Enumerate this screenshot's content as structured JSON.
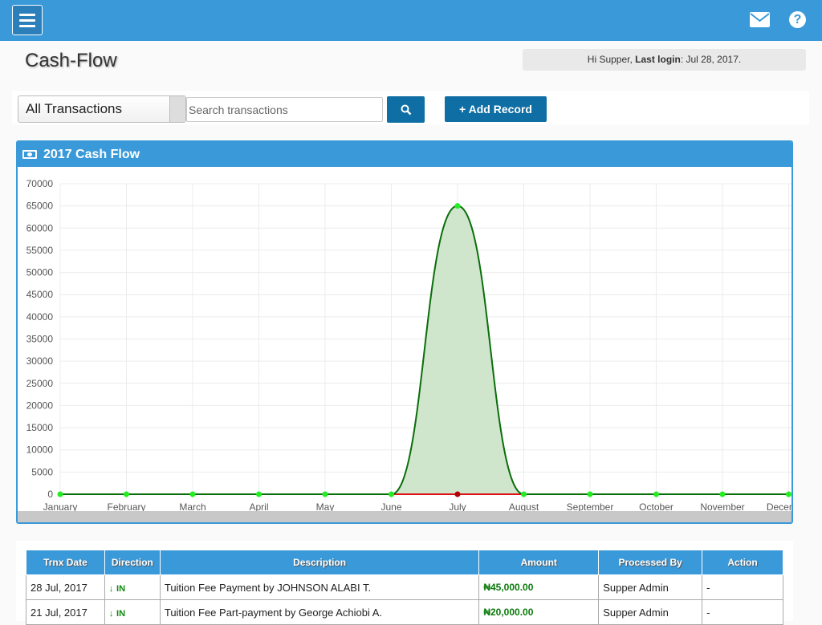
{
  "header": {
    "menu_icon": "hamburger-icon",
    "mail_icon": "envelope-icon",
    "help_icon": "question-circle-icon",
    "help_glyph": "?"
  },
  "page": {
    "title": "Cash-Flow",
    "greeting": "Hi Supper, ",
    "last_login_label": "Last login",
    "last_login_value": ": Jul 28, 2017."
  },
  "toolbar": {
    "filter_selected": "All Transactions",
    "search_placeholder": "Search transactions",
    "search_icon": "magnifier-icon",
    "add_label": "Add Record",
    "add_glyph": "+"
  },
  "panel": {
    "title": "2017 Cash Flow",
    "icon": "money-bill-icon"
  },
  "chart_data": {
    "type": "area",
    "title": "",
    "xlabel": "",
    "ylabel": "",
    "categories": [
      "January",
      "February",
      "March",
      "April",
      "May",
      "June",
      "July",
      "August",
      "September",
      "October",
      "November",
      "December"
    ],
    "ylim": [
      0,
      70000
    ],
    "yticks": [
      0,
      5000,
      10000,
      15000,
      20000,
      25000,
      30000,
      35000,
      40000,
      45000,
      50000,
      55000,
      60000,
      65000,
      70000
    ],
    "grid": true,
    "series": [
      {
        "values": [
          0,
          0,
          0,
          0,
          0,
          0,
          65000,
          0,
          0,
          0,
          0,
          0
        ],
        "color": "#0a6e0a",
        "fill": "#cfe6cc",
        "point_color": "#22ee22"
      },
      {
        "values": [
          0,
          0,
          0,
          0,
          0,
          0,
          0,
          0,
          0,
          0,
          0,
          0
        ],
        "color": "#d11",
        "point_color": "#b00000"
      }
    ]
  },
  "table": {
    "headers": [
      "Trnx Date",
      "Direction",
      "Description",
      "Amount",
      "Processed By",
      "Action"
    ],
    "rows": [
      {
        "date": "28 Jul, 2017",
        "direction": "IN",
        "description": "Tuition Fee Payment by JOHNSON ALABI T.",
        "amount": "₦45,000.00",
        "processed_by": "Supper Admin",
        "action": "-"
      },
      {
        "date": "21 Jul, 2017",
        "direction": "IN",
        "description": "Tuition Fee Part-payment by George Achiobi A.",
        "amount": "₦20,000.00",
        "processed_by": "Supper Admin",
        "action": "-"
      }
    ],
    "direction_icon": "arrow-down-icon"
  },
  "colors": {
    "brand": "#3a99d8",
    "button": "#0f6ea4",
    "in": "#0a8a0a"
  }
}
